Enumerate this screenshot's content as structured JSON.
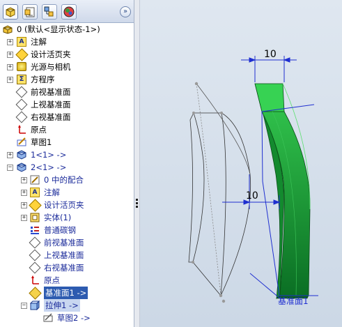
{
  "panel": {
    "tabs": [
      {
        "name": "featuremanager-tab",
        "active": true
      },
      {
        "name": "propertymanager-tab",
        "active": false
      },
      {
        "name": "configurationmanager-tab",
        "active": false
      },
      {
        "name": "appearance-tab",
        "active": false
      }
    ],
    "collapse_glyph": "»"
  },
  "tree": {
    "root_label": "0  (默认<显示状态-1>)",
    "items": [
      {
        "label": "注解"
      },
      {
        "label": "设计活页夹"
      },
      {
        "label": "光源与相机"
      },
      {
        "label": "方程序"
      },
      {
        "label": "前视基准面"
      },
      {
        "label": "上视基准面"
      },
      {
        "label": "右视基准面"
      },
      {
        "label": "原点"
      },
      {
        "label": "草图1"
      },
      {
        "label": "1<1> ->"
      },
      {
        "label": "2<1> ->"
      }
    ],
    "sub_items": [
      {
        "label": "0  中的配合"
      },
      {
        "label": "注解"
      },
      {
        "label": "设计活页夹"
      },
      {
        "label": "实体(1)"
      },
      {
        "label": "普通碳钢"
      },
      {
        "label": "前视基准面"
      },
      {
        "label": "上视基准面"
      },
      {
        "label": "右视基准面"
      },
      {
        "label": "原点"
      },
      {
        "label": "基准面1 ->"
      },
      {
        "label": "拉伸1 ->"
      },
      {
        "label": "草图2 ->"
      }
    ]
  },
  "viewport": {
    "dim_top": "10",
    "dim_mid": "10",
    "plane_label": "基准面1",
    "colors": {
      "body": "#1faa3a",
      "body_dark": "#0a6e22",
      "body_light": "#35c84e",
      "dim_line": "#1f2fd0"
    }
  }
}
